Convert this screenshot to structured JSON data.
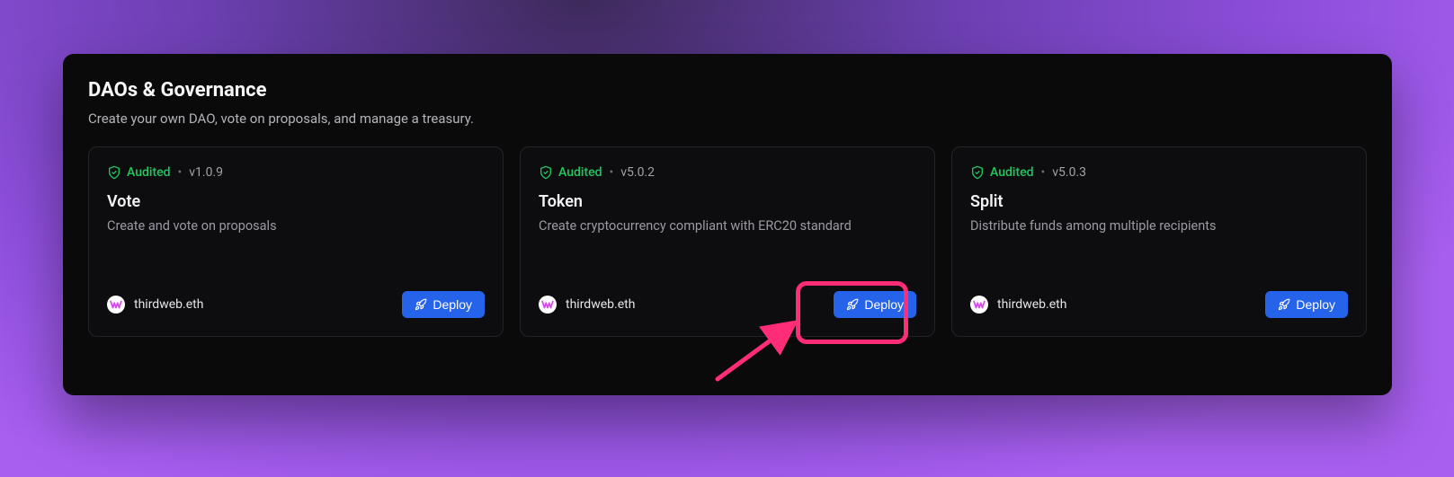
{
  "section": {
    "title": "DAOs & Governance",
    "subtitle": "Create your own DAO, vote on proposals, and manage a treasury."
  },
  "cards": [
    {
      "audited": "Audited",
      "version": "v1.0.9",
      "title": "Vote",
      "description": "Create and vote on proposals",
      "publisher": "thirdweb.eth",
      "deploy": "Deploy"
    },
    {
      "audited": "Audited",
      "version": "v5.0.2",
      "title": "Token",
      "description": "Create cryptocurrency compliant with ERC20 standard",
      "publisher": "thirdweb.eth",
      "deploy": "Deploy"
    },
    {
      "audited": "Audited",
      "version": "v5.0.3",
      "title": "Split",
      "description": "Distribute funds among multiple recipients",
      "publisher": "thirdweb.eth",
      "deploy": "Deploy"
    }
  ]
}
